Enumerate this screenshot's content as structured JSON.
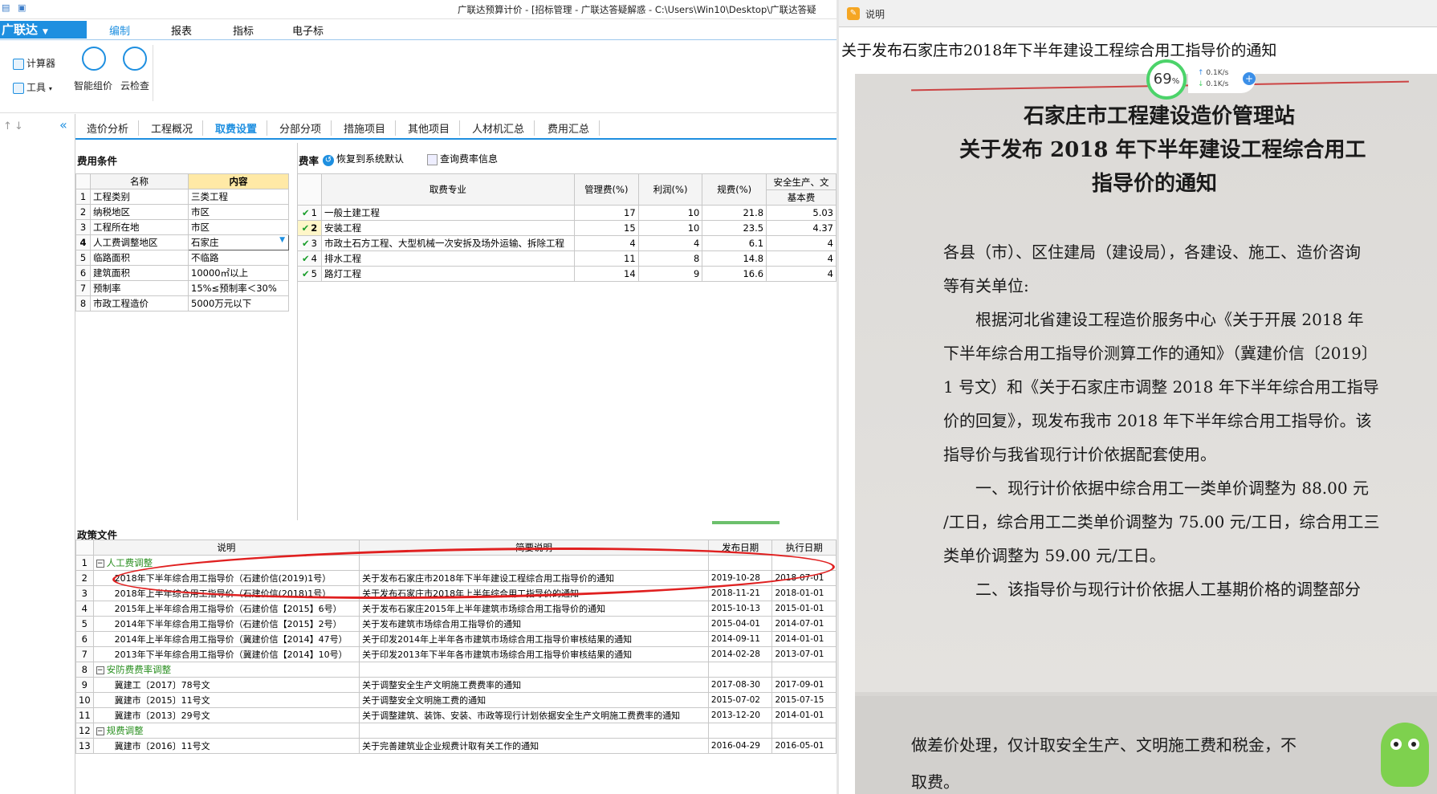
{
  "window": {
    "title": "广联达预算计价 - [招标管理 - 广联达答疑解惑 - C:\\Users\\Win10\\Desktop\\广联达答疑"
  },
  "brand": {
    "label": "广联达",
    "arrow": "▼"
  },
  "menu": {
    "tabs": [
      "编制",
      "报表",
      "指标",
      "电子标"
    ],
    "active": "编制"
  },
  "ribbon": {
    "calculator": "计算器",
    "tools": "工具",
    "smart_pricing": "智能组价",
    "cloud_check": "云检查"
  },
  "sidebar": {
    "collapse_icon": "«"
  },
  "subtabs": {
    "items": [
      "造价分析",
      "工程概况",
      "取费设置",
      "分部分项",
      "措施项目",
      "其他项目",
      "人材机汇总",
      "费用汇总"
    ],
    "active": "取费设置"
  },
  "fee_conditions": {
    "title": "费用条件",
    "headers": [
      "名称",
      "内容"
    ],
    "rows": [
      {
        "no": "1",
        "name": "工程类别",
        "value": "三类工程"
      },
      {
        "no": "2",
        "name": "纳税地区",
        "value": "市区"
      },
      {
        "no": "3",
        "name": "工程所在地",
        "value": "市区"
      },
      {
        "no": "4",
        "name": "人工费调整地区",
        "value": "石家庄"
      },
      {
        "no": "5",
        "name": "临路面积",
        "value": "不临路"
      },
      {
        "no": "6",
        "name": "建筑面积",
        "value": "10000㎡以上"
      },
      {
        "no": "7",
        "name": "预制率",
        "value": "15%≤预制率＜30%"
      },
      {
        "no": "8",
        "name": "市政工程造价",
        "value": "5000万元以下"
      }
    ]
  },
  "fee_rate": {
    "title": "费率",
    "restore_label": "恢复到系统默认",
    "query_label": "查询费率信息",
    "headers": {
      "specialty": "取费专业",
      "mgmt": "管理费(%)",
      "profit": "利润(%)",
      "regulation": "规费(%)",
      "safety": "安全生产、文",
      "safety_sub": "基本费"
    },
    "rows": [
      {
        "no": "1",
        "name": "一般土建工程",
        "mgmt": "17",
        "profit": "10",
        "reg": "21.8",
        "safety": "5.03"
      },
      {
        "no": "2",
        "name": "安装工程",
        "mgmt": "15",
        "profit": "10",
        "reg": "23.5",
        "safety": "4.37"
      },
      {
        "no": "3",
        "name": "市政土石方工程、大型机械一次安拆及场外运输、拆除工程",
        "mgmt": "4",
        "profit": "4",
        "reg": "6.1",
        "safety": "4"
      },
      {
        "no": "4",
        "name": "排水工程",
        "mgmt": "11",
        "profit": "8",
        "reg": "14.8",
        "safety": "4"
      },
      {
        "no": "5",
        "name": "路灯工程",
        "mgmt": "14",
        "profit": "9",
        "reg": "16.6",
        "safety": "4"
      }
    ]
  },
  "policy": {
    "title": "政策文件",
    "headers": [
      "说明",
      "简要说明",
      "发布日期",
      "执行日期"
    ],
    "rows": [
      {
        "no": "1",
        "group": true,
        "desc": "人工费调整",
        "brief": "",
        "pub": "",
        "exec": ""
      },
      {
        "no": "2",
        "group": false,
        "desc": "2018年下半年综合用工指导价（石建价信(2019)1号）",
        "brief": "关于发布石家庄市2018年下半年建设工程综合用工指导价的通知",
        "pub": "2019-10-28",
        "exec": "2018-07-01"
      },
      {
        "no": "3",
        "group": false,
        "desc": "2018年上半年综合用工指导价（石建价信(2018)1号）",
        "brief": "关于发布石家庄市2018年上半年综合用工指导价的通知",
        "pub": "2018-11-21",
        "exec": "2018-01-01"
      },
      {
        "no": "4",
        "group": false,
        "desc": "2015年上半年综合用工指导价（石建价信【2015】6号）",
        "brief": "关于发布石家庄2015年上半年建筑市场综合用工指导价的通知",
        "pub": "2015-10-13",
        "exec": "2015-01-01"
      },
      {
        "no": "5",
        "group": false,
        "desc": "2014年下半年综合用工指导价（石建价信【2015】2号）",
        "brief": "关于发布建筑市场综合用工指导价的通知",
        "pub": "2015-04-01",
        "exec": "2014-07-01"
      },
      {
        "no": "6",
        "group": false,
        "desc": "2014年上半年综合用工指导价（冀建价信【2014】47号）",
        "brief": "关于印发2014年上半年各市建筑市场综合用工指导价审核结果的通知",
        "pub": "2014-09-11",
        "exec": "2014-01-01"
      },
      {
        "no": "7",
        "group": false,
        "desc": "2013年下半年综合用工指导价（冀建价信【2014】10号）",
        "brief": "关于印发2013年下半年各市建筑市场综合用工指导价审核结果的通知",
        "pub": "2014-02-28",
        "exec": "2013-07-01"
      },
      {
        "no": "8",
        "group": true,
        "desc": "安防费费率调整",
        "brief": "",
        "pub": "",
        "exec": ""
      },
      {
        "no": "9",
        "group": false,
        "desc": "冀建工〔2017〕78号文",
        "brief": "关于调整安全生产文明施工费费率的通知",
        "pub": "2017-08-30",
        "exec": "2017-09-01"
      },
      {
        "no": "10",
        "group": false,
        "desc": "冀建市〔2015〕11号文",
        "brief": "关于调整安全文明施工费的通知",
        "pub": "2015-07-02",
        "exec": "2015-07-15"
      },
      {
        "no": "11",
        "group": false,
        "desc": "冀建市〔2013〕29号文",
        "brief": "关于调整建筑、装饰、安装、市政等现行计划依据安全生产文明施工费费率的通知",
        "pub": "2013-12-20",
        "exec": "2014-01-01"
      },
      {
        "no": "12",
        "group": true,
        "desc": "规费调整",
        "brief": "",
        "pub": "",
        "exec": ""
      },
      {
        "no": "13",
        "group": false,
        "desc": "冀建市〔2016〕11号文",
        "brief": "关于完善建筑业企业规费计取有关工作的通知",
        "pub": "2016-04-29",
        "exec": "2016-05-01"
      }
    ]
  },
  "viewer": {
    "app_title": "说明",
    "notice_title": "关于发布石家庄市2018年下半年建设工程综合用工指导价的通知",
    "doc_lines": {
      "h1": "石家庄市工程建设造价管理站",
      "h2": "关于发布 2018 年下半年建设工程综合用工",
      "h3": "指导价的通知",
      "b1": "各县（市）、区住建局（建设局），各建设、施工、造价咨询",
      "b2": "等有关单位:",
      "b3": "根据河北省建设工程造价服务中心《关于开展 2018 年",
      "b4": "下半年综合用工指导价测算工作的通知》（冀建价信〔2019〕",
      "b5": "1 号文）和《关于石家庄市调整 2018 年下半年综合用工指导",
      "b6": "价的回复》，现发布我市 2018 年下半年综合用工指导价。该",
      "b7": "指导价与我省现行计价依据配套使用。",
      "b8": "一、现行计价依据中综合用工一类单价调整为 88.00 元",
      "b9": "/工日，综合用工二类单价调整为 75.00 元/工日，综合用工三",
      "b10": "类单价调整为 59.00 元/工日。",
      "b11": "二、该指导价与现行计价依据人工基期价格的调整部分",
      "b12": "做差价处理，仅计取安全生产、文明施工费和税金，不",
      "b13": "取费。"
    }
  },
  "net_widget": {
    "percent": "69",
    "unit": "%",
    "up": "0.1K/s",
    "down": "0.1K/s"
  }
}
